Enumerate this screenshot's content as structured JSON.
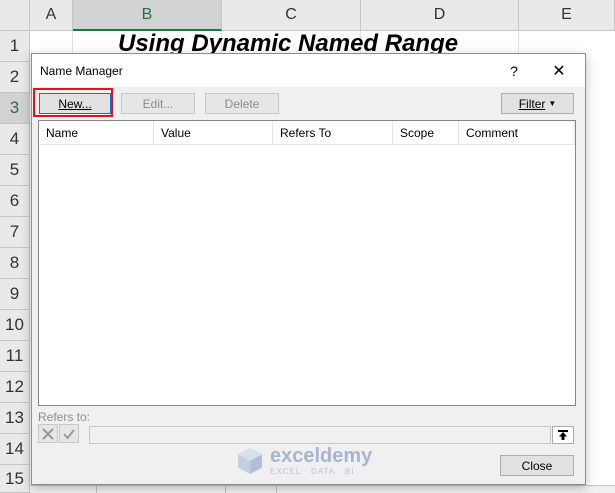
{
  "sheet": {
    "columns": [
      "A",
      "B",
      "C",
      "D",
      "E"
    ],
    "rows": [
      "1",
      "2",
      "3",
      "4",
      "5",
      "6",
      "7",
      "8",
      "9",
      "10",
      "11",
      "12",
      "13",
      "14",
      "15"
    ],
    "title_cell": "Using Dynamic Named Range"
  },
  "dialog": {
    "title": "Name Manager",
    "help_label": "?",
    "close_label": "✕",
    "buttons": {
      "new": "New...",
      "edit": "Edit...",
      "delete": "Delete",
      "filter": "Filter",
      "close": "Close"
    },
    "list_columns": [
      "Name",
      "Value",
      "Refers To",
      "Scope",
      "Comment"
    ],
    "refers_to_label": "Refers to:",
    "refers_to_value": "",
    "icons": {
      "cancel": "x-icon",
      "confirm": "check-icon",
      "collapse": "collapse-arrow-icon"
    }
  },
  "watermark": {
    "brand": "exceldemy",
    "tagline": "EXCEL · DATA · BI"
  },
  "colors": {
    "excel_green": "#217346",
    "highlight_red": "#e0141e",
    "focus_blue": "#0078d7"
  }
}
